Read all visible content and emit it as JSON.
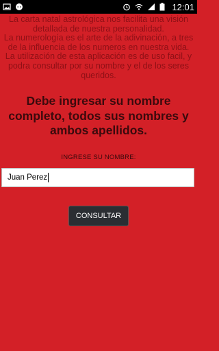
{
  "status_bar": {
    "time": "12:01",
    "icons_left": [
      "image-icon",
      "chat-bubble-icon"
    ],
    "icons_right": [
      "alarm-icon",
      "wifi-icon",
      "signal-icon",
      "battery-icon"
    ]
  },
  "intro": {
    "p1": "La carta natal astrológica nos facilita una visión detallada de nuestra personalidad.",
    "p2": "La numerología es el arte de la adivinación, a tres de la influencia de los numeros en nuestra vida.",
    "p3": "La utilización de esta aplicación es de uso facil, y podra consultar por su nombre y el de los seres queridos."
  },
  "headline": "Debe ingresar su nombre completo, todos sus nombres y ambos apellidos.",
  "form": {
    "label": "INGRESE SU NOMBRE:",
    "name_value": "Juan Perez",
    "button_label": "CONSULTAR"
  }
}
